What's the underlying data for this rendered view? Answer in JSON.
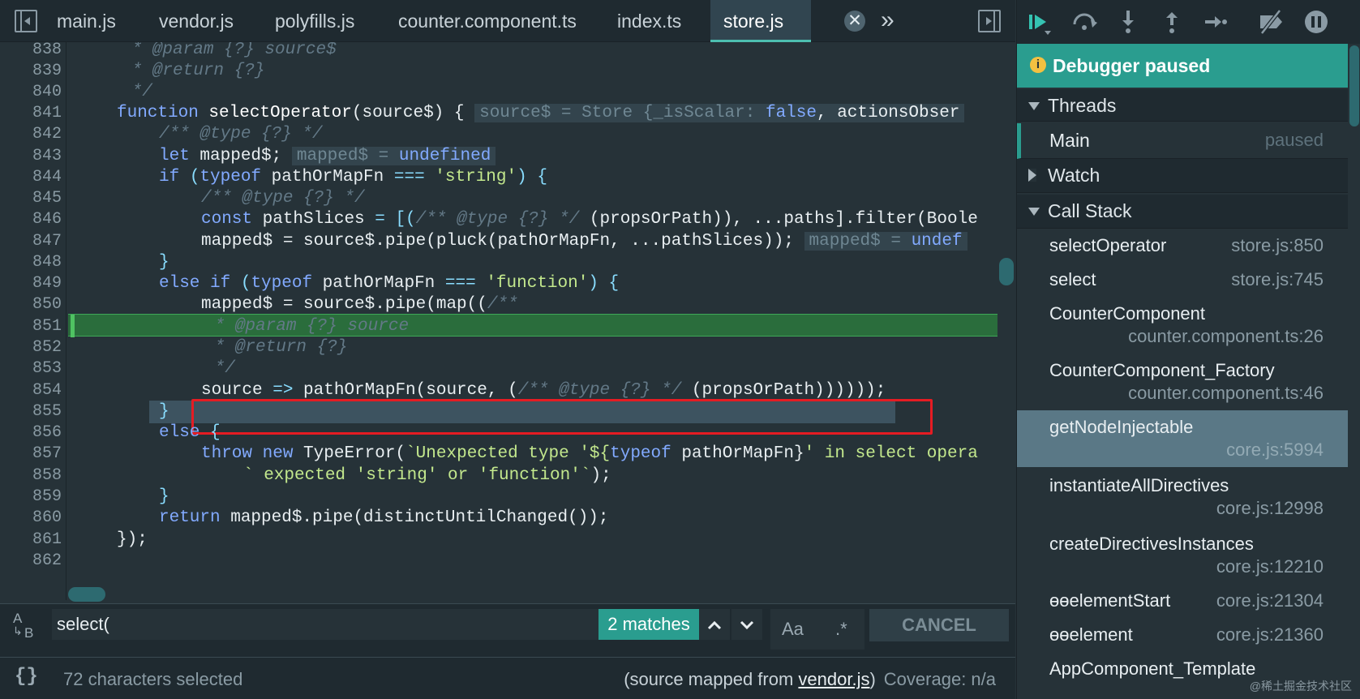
{
  "tabs": {
    "items": [
      "main.js",
      "vendor.js",
      "polyfills.js",
      "counter.component.ts",
      "index.ts",
      "store.js"
    ],
    "active": "store.js",
    "close_glyph": "✕",
    "more_glyph": "»"
  },
  "editor": {
    "line_numbers": [
      "838",
      "839",
      "840",
      "841",
      "842",
      "843",
      "844",
      "845",
      "846",
      "847",
      "848",
      "849",
      "850",
      "851",
      "852",
      "853",
      "854",
      "855",
      "856",
      "857",
      "858",
      "859",
      "860",
      "861",
      "862"
    ],
    "lines": {
      "l838": " * @param {?} source$",
      "l839": " * @return {?}",
      "l840": " */",
      "l841": {
        "kw": "function ",
        "name": "selectOperator",
        "rest": "(source$) {",
        "inline_value": {
          "pre": "source$ = Store {_isScalar",
          "colon": ":",
          "key": " false",
          "post": ", actionsObser"
        }
      },
      "l842": "/** @type {?} */",
      "l843": {
        "kw": "let ",
        "rest": "mapped$;",
        "inline_value": {
          "pre": "mapped$ = ",
          "val": "undefined"
        }
      },
      "l844": {
        "kw1": "if ",
        "p1": "(",
        "kw2": "typeof ",
        "mid": "pathOrMapFn ",
        "op": "=== ",
        "str": "'string'",
        "end": ") {"
      },
      "l845": "/** @type {?} */",
      "l846": {
        "kw": "const ",
        "a": "pathSlices ",
        "b": "= [(",
        "cm": "/** @type {?} */",
        "c": " (propsOrPath)), ...paths].filter(Boole"
      },
      "l847": {
        "a": "mapped$ = source$.pipe(pluck(pathOrMapFn, ...pathSlices));",
        "inline_value": {
          "pre": "mapped$ = ",
          "val": "undef"
        }
      },
      "l848": "}",
      "l849": {
        "kw1": "else if ",
        "p1": "(",
        "kw2": "typeof ",
        "mid": "pathOrMapFn ",
        "op": "=== ",
        "str": "'function'",
        "end": ") {"
      },
      "l850": {
        "a": "mapped$ = source$.pipe(map((",
        "cm": "/**"
      },
      "l851": " * @param {?} source",
      "l852": " * @return {?}",
      "l853": " */",
      "l854": {
        "a": "source ",
        "op": "=> ",
        "b": "pathOrMapFn(source, (",
        "cm": "/** @type {?} */",
        "c": " (propsOrPath))))));"
      },
      "l855": "}",
      "l856": {
        "kw": "else ",
        "rest": "{"
      },
      "l857": {
        "kw1": "throw ",
        "kw2": "new ",
        "a": "TypeError(",
        "str": "`Unexpected type '${",
        "kw3": "typeof ",
        "b": "pathOrMapFn}",
        "str2": "' in select opera"
      },
      "l858": {
        "str": "` expected 'string' or 'function'`",
        "end": ");"
      },
      "l859": "}",
      "l860": {
        "kw": "return ",
        "rest": "mapped$.pipe(distinctUntilChanged());"
      },
      "l861": "});"
    }
  },
  "search": {
    "query": "select(",
    "matches_label": "2 matches",
    "case_label": "Aa",
    "regex_label": ".*",
    "cancel_label": "CANCEL",
    "icon_a": "A",
    "icon_b": "B"
  },
  "status": {
    "selection": "72 characters selected",
    "braces": "{}",
    "source_prefix": "(source mapped from ",
    "source_link": "vendor.js",
    "source_suffix": ")",
    "coverage": "Coverage: n/a"
  },
  "debugger": {
    "banner": "Debugger paused",
    "info_glyph": "i",
    "sections": {
      "threads": "Threads",
      "watch": "Watch",
      "call_stack": "Call Stack"
    },
    "thread": {
      "name": "Main",
      "status": "paused"
    },
    "call_stack": [
      {
        "fn": "selectOperator",
        "loc": "store.js:850"
      },
      {
        "fn": "select",
        "loc": "store.js:745"
      },
      {
        "fn": "CounterComponent",
        "loc": "counter.component.ts:26"
      },
      {
        "fn": "CounterComponent_Factory",
        "loc": "counter.component.ts:46"
      },
      {
        "fn": "getNodeInjectable",
        "loc": "core.js:5994"
      },
      {
        "fn": "instantiateAllDirectives",
        "loc": "core.js:12998"
      },
      {
        "fn": "createDirectivesInstances",
        "loc": "core.js:12210"
      },
      {
        "fn": "ɵɵelementStart",
        "loc": "core.js:21304"
      },
      {
        "fn": "ɵɵelement",
        "loc": "core.js:21360"
      },
      {
        "fn": "AppComponent_Template",
        "loc": ""
      }
    ]
  },
  "watermark": "@稀土掘金技术社区",
  "colors": {
    "accent": "#2a9d8f",
    "paused_line": "#2a6d3c",
    "selection_box": "#e51c23"
  }
}
